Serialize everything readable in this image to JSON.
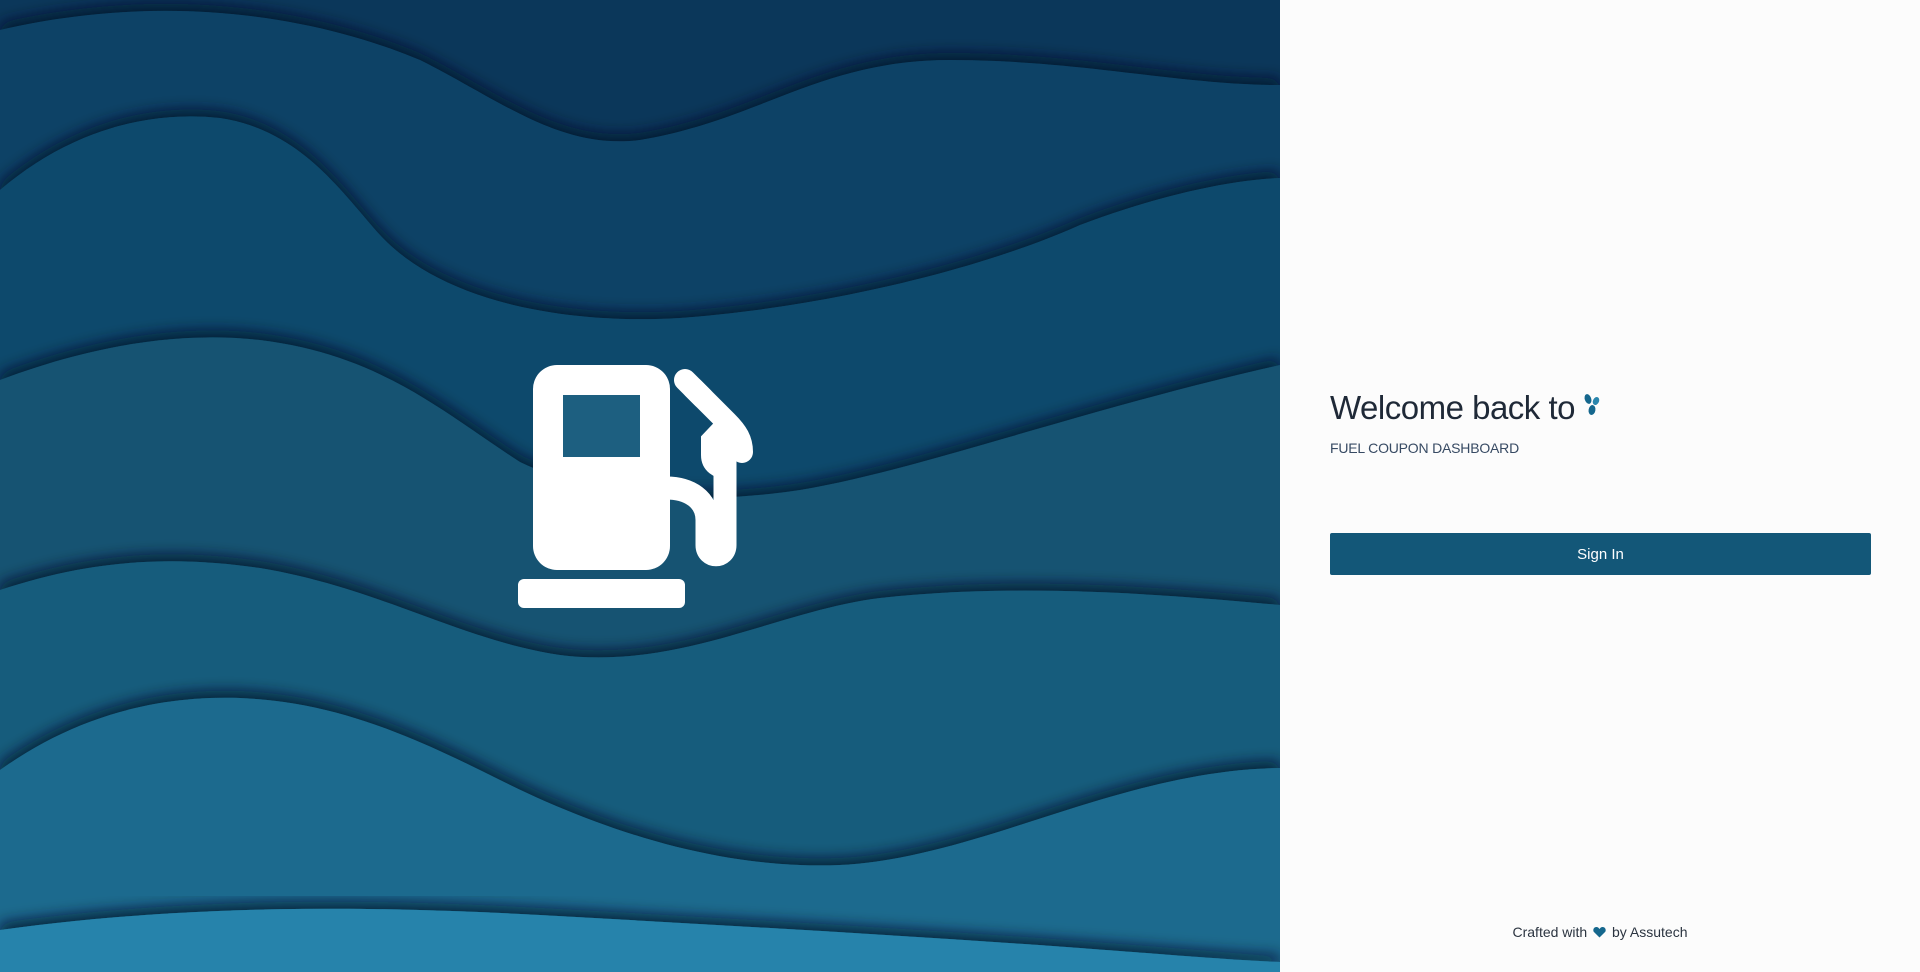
{
  "hero": {
    "pump_icon": "fuel-pump-icon",
    "colors": {
      "deep": "#0c3a5a",
      "mid": "#195e80",
      "light": "#2a90b8"
    }
  },
  "auth": {
    "title": "Welcome back to",
    "brand_icon": "droplets-logo-icon",
    "subtitle": "FUEL COUPON DASHBOARD",
    "sign_in_label": "Sign In",
    "accent": "#135778"
  },
  "footer": {
    "prefix": "Crafted with",
    "heart_icon": "heart-icon",
    "suffix": "by Assutech"
  }
}
